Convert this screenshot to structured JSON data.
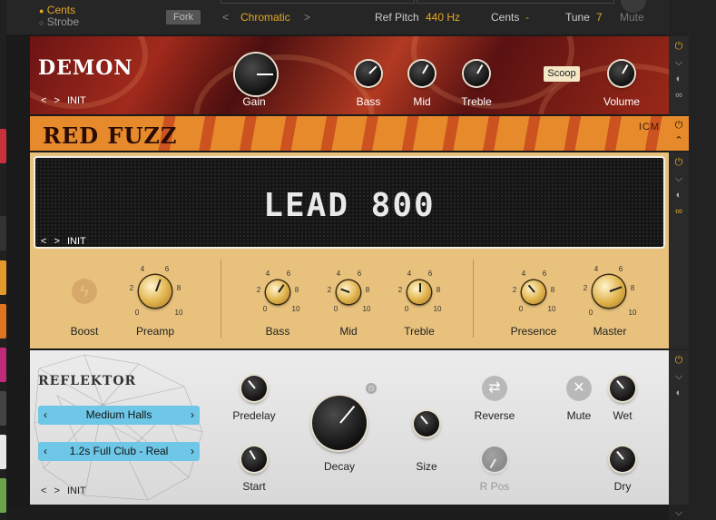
{
  "topbar": {
    "cents_label": "Cents",
    "strobe_label": "Strobe",
    "fork_label": "Fork",
    "mode_prev": "<",
    "mode_value": "Chromatic",
    "mode_next": ">",
    "refpitch_label": "Ref Pitch",
    "refpitch_value": "440 Hz",
    "cents2_label": "Cents",
    "cents2_value": "-",
    "tune_label": "Tune",
    "tune_value": "7",
    "mute_label": "Mute"
  },
  "demon": {
    "logo": "DEMON",
    "nav_prev": "<",
    "nav_next": ">",
    "preset": "INIT",
    "knobs": {
      "gain": "Gain",
      "bass": "Bass",
      "mid": "Mid",
      "treble": "Treble",
      "volume": "Volume"
    },
    "scoop_label": "Scoop"
  },
  "redfuzz": {
    "logo": "RED FUZZ",
    "brand": "ICM"
  },
  "lead": {
    "title": "LEAD 800",
    "nav_prev": "<",
    "nav_next": ">",
    "preset": "INIT",
    "labels": {
      "boost": "Boost",
      "preamp": "Preamp",
      "bass": "Bass",
      "mid": "Mid",
      "treble": "Treble",
      "presence": "Presence",
      "master": "Master"
    },
    "ticks": [
      "0",
      "2",
      "4",
      "6",
      "8",
      "10"
    ]
  },
  "reflektor": {
    "logo": "REFLEKTOR",
    "room_value": "Medium Halls",
    "ir_value": "1.2s Full Club - Real",
    "nav_prev": "<",
    "nav_next": ">",
    "preset": "INIT",
    "labels": {
      "predelay": "Predelay",
      "start": "Start",
      "decay": "Decay",
      "size": "Size",
      "reverse": "Reverse",
      "rpos": "R Pos",
      "mute": "Mute",
      "wet": "Wet",
      "dry": "Dry"
    }
  },
  "colors": {
    "accent": "#e5a823",
    "power": "#e5a823",
    "pill": "#6ec7e6"
  }
}
